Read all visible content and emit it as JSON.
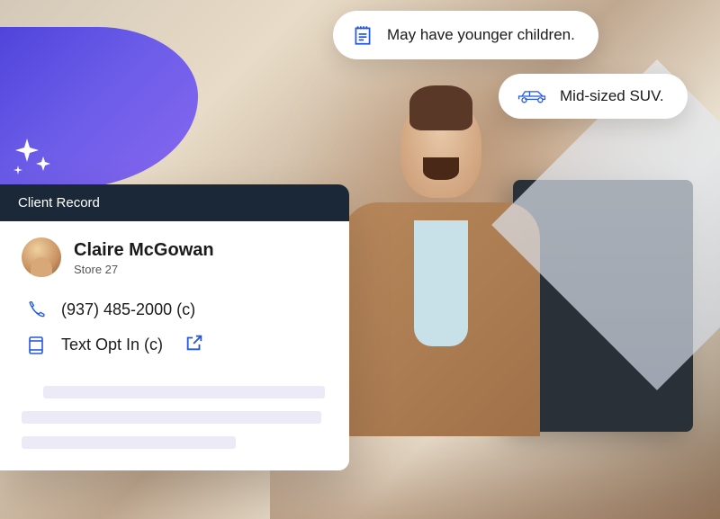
{
  "card": {
    "header": "Client Record",
    "name": "Claire McGowan",
    "store": "Store 27",
    "phone": "(937) 485-2000 (c)",
    "text_opt": "Text Opt In (c)"
  },
  "bubbles": {
    "b1": "May have younger children.",
    "b2": "Mid-sized SUV."
  }
}
